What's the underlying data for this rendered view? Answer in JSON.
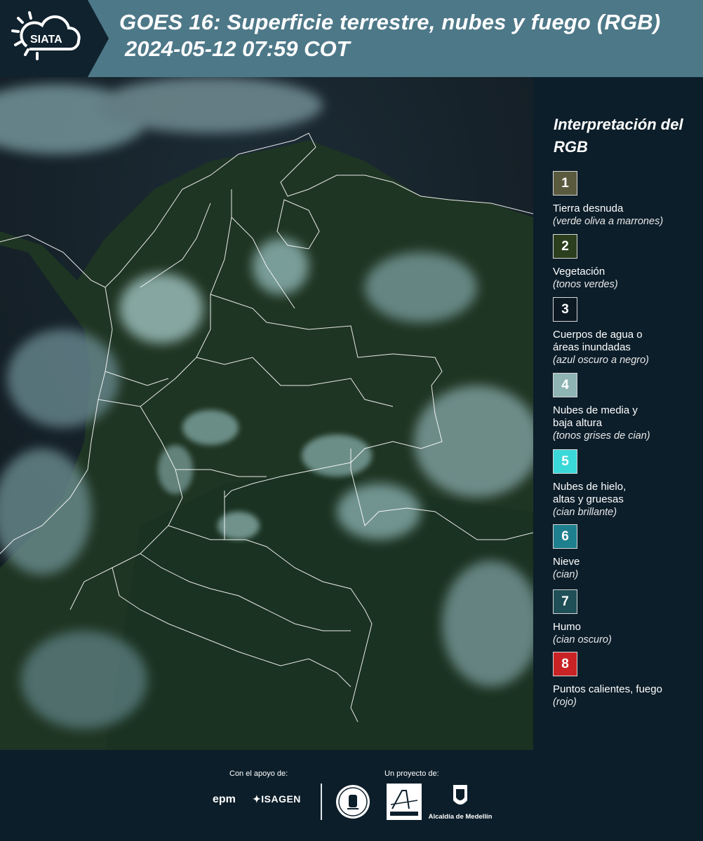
{
  "header": {
    "logo_text": "SIATA",
    "title": "GOES 16: Superficie terrestre, nubes y fuego (RGB)",
    "subtitle": "2024-05-12 07:59 COT"
  },
  "legend": {
    "title": "Interpretación del RGB",
    "items": [
      {
        "number": "1",
        "label": "Tierra desnuda",
        "sub": "(verde oliva a marrones)",
        "color": "#5a5a3e"
      },
      {
        "number": "2",
        "label": "Vegetación",
        "sub": "(tonos verdes)",
        "color": "#2b3e1d"
      },
      {
        "number": "3",
        "label": "Cuerpos de agua o áreas inundadas",
        "sub": "(azul oscuro a negro)",
        "color": "#0c1822"
      },
      {
        "number": "4",
        "label": "Nubes de media y baja altura",
        "sub": "(tonos grises de cian)",
        "color": "#8fb4b4"
      },
      {
        "number": "5",
        "label": "Nubes de hielo, altas y gruesas",
        "sub": "(cian brillante)",
        "color": "#3ad8d8"
      },
      {
        "number": "6",
        "label": "Nieve",
        "sub": "(cian)",
        "color": "#1e7f8e"
      },
      {
        "number": "7",
        "label": "Humo",
        "sub": "(cian oscuro)",
        "color": "#1f4f57"
      },
      {
        "number": "8",
        "label": "Puntos calientes, fuego",
        "sub": "(rojo)",
        "color": "#c92325"
      }
    ]
  },
  "footer": {
    "support_label": "Con el apoyo de:",
    "project_label": "Un proyecto de:",
    "sponsor_1": "epm",
    "sponsor_2": "ISAGEN",
    "partner_area": "Área Metropolitana",
    "partner_alcaldia": "Alcaldía de Medellín"
  },
  "colors": {
    "header_bg": "#4d7888",
    "page_bg": "#0c1e2a",
    "border_lines": "#ffffff",
    "vegetation": "#1f3a22",
    "cloud_cyan": "#9fc9c8"
  }
}
